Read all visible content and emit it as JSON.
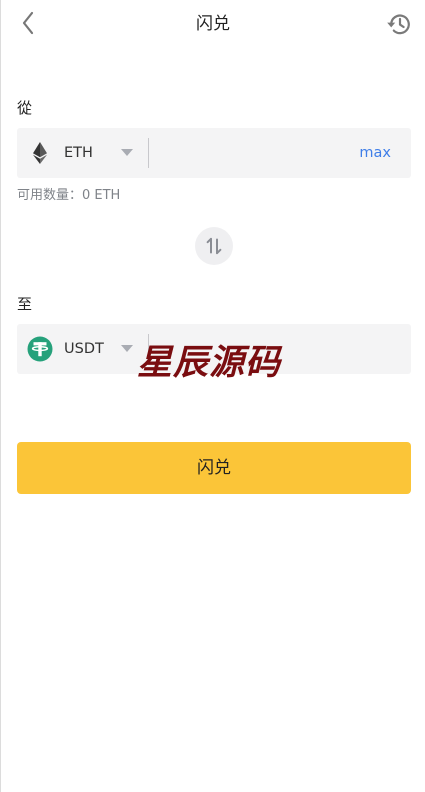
{
  "header": {
    "title": "闪兑"
  },
  "from": {
    "label": "從",
    "token": "ETH",
    "amount_value": "",
    "max_label": "max",
    "available_text": "可用数量：0 ETH"
  },
  "to": {
    "label": "至",
    "token": "USDT",
    "amount_value": ""
  },
  "watermark": "星辰源码",
  "submit": {
    "label": "闪兑"
  },
  "colors": {
    "accent_button": "#fbc538",
    "link_blue": "#3f7ee8",
    "input_background": "#f4f4f5",
    "usdt_green": "#26a17b",
    "watermark": "#7a0d10"
  },
  "icons": {
    "back": "chevron-left-icon",
    "history": "history-icon",
    "swap": "swap-vertical-icon",
    "eth": "ethereum-logo-icon",
    "usdt": "tether-logo-icon",
    "caret": "caret-down-icon"
  }
}
